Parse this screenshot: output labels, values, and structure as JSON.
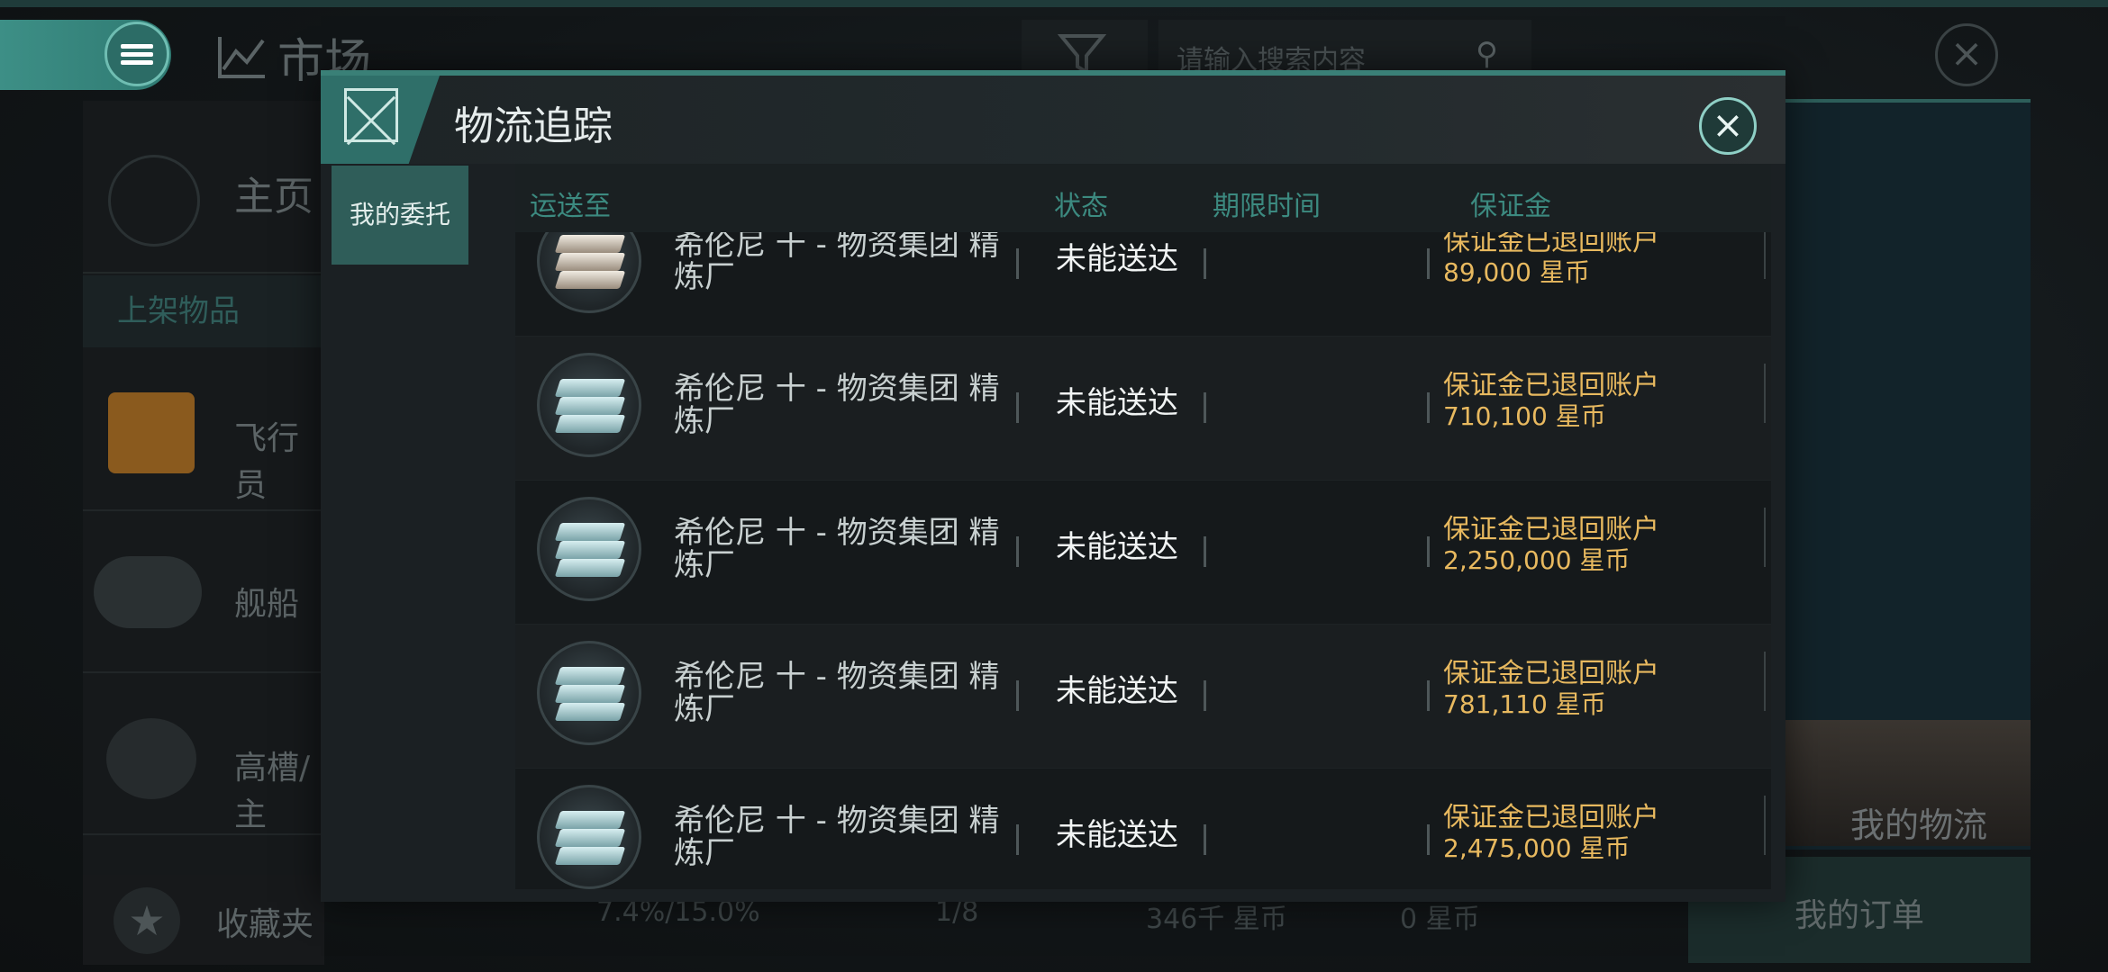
{
  "background": {
    "market_title": "市场",
    "search_placeholder": "请输入搜索内容",
    "home_label": "主页",
    "listing_header": "上架物品",
    "categories": [
      "飞行员",
      "舰船",
      "高槽/主"
    ],
    "favorites_label": "收藏夹",
    "footer": {
      "tax": "7.4%/15.0%",
      "slots": "1/8",
      "balance": "346千 星币",
      "escrow": "0 星币"
    },
    "my_logistics_label": "我的物流",
    "my_orders_label": "我的订单"
  },
  "dialog": {
    "title": "物流追踪",
    "side_tab": "我的委托",
    "columns": {
      "destination": "运送至",
      "status": "状态",
      "deadline": "期限时间",
      "deposit": "保证金"
    },
    "rows": [
      {
        "icon": "silver-ingot-icon",
        "destination": "希伦尼 十 - 物资集团 精炼厂",
        "status": "未能送达",
        "deposit_text": "保证金已退回账户",
        "deposit_amount": "89,000 星币"
      },
      {
        "icon": "teal-ingot-icon",
        "destination": "希伦尼 十 - 物资集团 精炼厂",
        "status": "未能送达",
        "deposit_text": "保证金已退回账户",
        "deposit_amount": "710,100 星币"
      },
      {
        "icon": "teal-ingot-icon",
        "destination": "希伦尼 十 - 物资集团 精炼厂",
        "status": "未能送达",
        "deposit_text": "保证金已退回账户",
        "deposit_amount": "2,250,000 星币"
      },
      {
        "icon": "teal-ingot-icon",
        "destination": "希伦尼 十 - 物资集团 精炼厂",
        "status": "未能送达",
        "deposit_text": "保证金已退回账户",
        "deposit_amount": "781,110 星币"
      },
      {
        "icon": "teal-ingot-icon",
        "destination": "希伦尼 十 - 物资集团 精炼厂",
        "status": "未能送达",
        "deposit_text": "保证金已退回账户",
        "deposit_amount": "2,475,000 星币"
      }
    ]
  },
  "colors": {
    "accent": "#3a8077",
    "deposit": "#e8b95f",
    "header_text": "#3c8a80"
  }
}
